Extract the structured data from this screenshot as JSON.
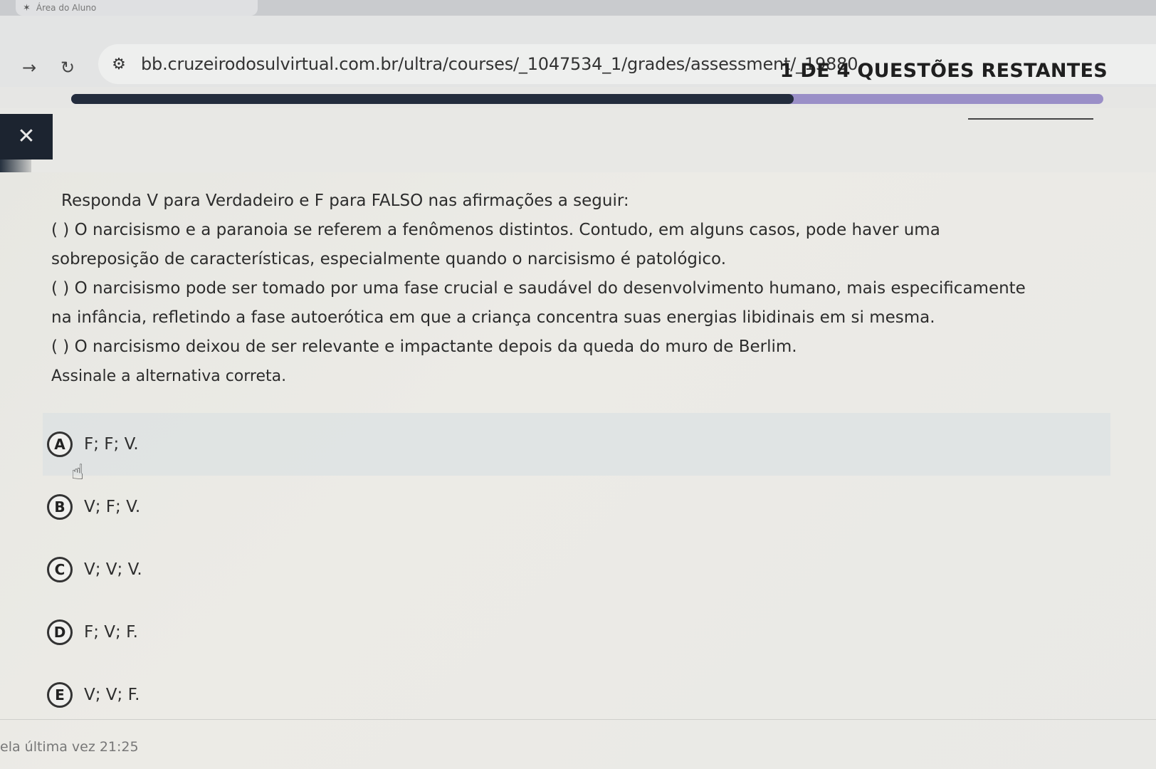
{
  "browser": {
    "tab_title": "Área do Aluno",
    "url": "bb.cruzeirodosulvirtual.com.br/ultra/courses/_1047534_1/grades/assessment/_19880"
  },
  "progress": {
    "fraction": 0.7
  },
  "header": {
    "remaining": "1 DE 4 QUESTÕES RESTANTES"
  },
  "question": {
    "intro": "Responda V para Verdadeiro e F para FALSO nas afirmações a seguir:",
    "s1_line1": "( ) O narcisismo e a paranoia se referem a fenômenos distintos. Contudo, em alguns casos, pode haver uma",
    "s1_line2": "sobreposição de características, especialmente quando o narcisismo é patológico.",
    "s2_line1": "( ) O narcisismo pode ser tomado por uma fase crucial e saudável do desenvolvimento humano, mais especificamente",
    "s2_line2": "na infância, refletindo a fase autoerótica em que a criança concentra suas energias libidinais em si mesma.",
    "s3": "( ) O narcisismo deixou de ser relevante e impactante depois da queda do muro de Berlim.",
    "ask": "Assinale a alternativa correta."
  },
  "options": [
    {
      "letter": "A",
      "text": "F; F; V."
    },
    {
      "letter": "B",
      "text": "V; F; V."
    },
    {
      "letter": "C",
      "text": "V; V; V."
    },
    {
      "letter": "D",
      "text": "F; V; F."
    },
    {
      "letter": "E",
      "text": "V; V; F."
    }
  ],
  "footer": {
    "text": "ela última vez 21:25"
  }
}
